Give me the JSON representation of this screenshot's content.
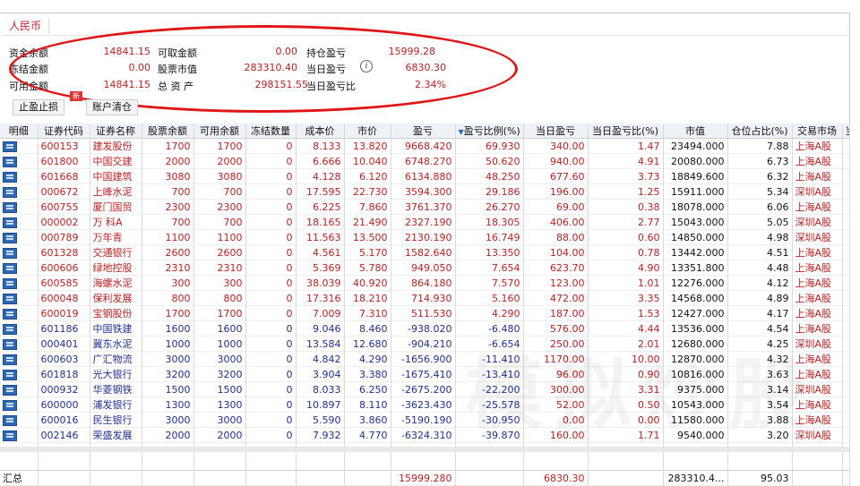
{
  "tab_currency": "人民币",
  "summary": {
    "fund_balance_label": "资金余额",
    "fund_balance": "14841.15",
    "withdrawable_label": "可取金额",
    "withdrawable": "0.00",
    "position_pl_label": "持仓盈亏",
    "position_pl": "15999.28",
    "frozen_label": "冻结金额",
    "frozen": "0.00",
    "stock_value_label": "股票市值",
    "stock_value": "283310.40",
    "today_pl_label": "当日盈亏",
    "today_pl": "6830.30",
    "available_label": "可用金额",
    "available": "14841.15",
    "total_assets_label": "总 资 产",
    "total_assets": "298151.55",
    "today_pl_ratio_label": "当日盈亏比",
    "today_pl_ratio": "2.34%"
  },
  "buttons": {
    "stop_label": "止盈止损",
    "clear_label": "账户清仓",
    "new_badge": "新"
  },
  "columns": [
    "明细",
    "证券代码",
    "证券名称",
    "股票余额",
    "可用余额",
    "冻结数量",
    "成本价",
    "市价",
    "盈亏",
    "盈亏比例(%)",
    "当日盈亏",
    "当日盈亏比(%)",
    "市值",
    "仓位占比(%)",
    "交易市场",
    "当"
  ],
  "rows": [
    {
      "code": "600153",
      "name": "建发股份",
      "bal": "1700",
      "avail": "1700",
      "frozen": "0",
      "cost": "8.133",
      "price": "13.820",
      "pl": "9668.420",
      "plr": "69.930",
      "tpl": "340.00",
      "tplr": "1.47",
      "mv": "23494.000",
      "pos": "7.88",
      "mkt": "上海A股",
      "sign": "up"
    },
    {
      "code": "601800",
      "name": "中国交建",
      "bal": "2000",
      "avail": "2000",
      "frozen": "0",
      "cost": "6.666",
      "price": "10.040",
      "pl": "6748.270",
      "plr": "50.620",
      "tpl": "940.00",
      "tplr": "4.91",
      "mv": "20080.000",
      "pos": "6.73",
      "mkt": "上海A股",
      "sign": "up"
    },
    {
      "code": "601668",
      "name": "中国建筑",
      "bal": "3080",
      "avail": "3080",
      "frozen": "0",
      "cost": "4.128",
      "price": "6.120",
      "pl": "6134.880",
      "plr": "48.250",
      "tpl": "677.60",
      "tplr": "3.73",
      "mv": "18849.600",
      "pos": "6.32",
      "mkt": "上海A股",
      "sign": "up"
    },
    {
      "code": "000672",
      "name": "上峰水泥",
      "bal": "700",
      "avail": "700",
      "frozen": "0",
      "cost": "17.595",
      "price": "22.730",
      "pl": "3594.300",
      "plr": "29.186",
      "tpl": "196.00",
      "tplr": "1.25",
      "mv": "15911.000",
      "pos": "5.34",
      "mkt": "深圳A股",
      "sign": "up"
    },
    {
      "code": "600755",
      "name": "厦门国贸",
      "bal": "2300",
      "avail": "2300",
      "frozen": "0",
      "cost": "6.225",
      "price": "7.860",
      "pl": "3761.370",
      "plr": "26.270",
      "tpl": "69.00",
      "tplr": "0.38",
      "mv": "18078.000",
      "pos": "6.06",
      "mkt": "上海A股",
      "sign": "up"
    },
    {
      "code": "000002",
      "name": "万 科A",
      "bal": "700",
      "avail": "700",
      "frozen": "0",
      "cost": "18.165",
      "price": "21.490",
      "pl": "2327.190",
      "plr": "18.305",
      "tpl": "406.00",
      "tplr": "2.77",
      "mv": "15043.000",
      "pos": "5.05",
      "mkt": "深圳A股",
      "sign": "up"
    },
    {
      "code": "000789",
      "name": "万年青",
      "bal": "1100",
      "avail": "1100",
      "frozen": "0",
      "cost": "11.563",
      "price": "13.500",
      "pl": "2130.190",
      "plr": "16.749",
      "tpl": "88.00",
      "tplr": "0.60",
      "mv": "14850.000",
      "pos": "4.98",
      "mkt": "深圳A股",
      "sign": "up"
    },
    {
      "code": "601328",
      "name": "交通银行",
      "bal": "2600",
      "avail": "2600",
      "frozen": "0",
      "cost": "4.561",
      "price": "5.170",
      "pl": "1582.640",
      "plr": "13.350",
      "tpl": "104.00",
      "tplr": "0.78",
      "mv": "13442.000",
      "pos": "4.51",
      "mkt": "上海A股",
      "sign": "up"
    },
    {
      "code": "600606",
      "name": "绿地控股",
      "bal": "2310",
      "avail": "2310",
      "frozen": "0",
      "cost": "5.369",
      "price": "5.780",
      "pl": "949.050",
      "plr": "7.654",
      "tpl": "623.70",
      "tplr": "4.90",
      "mv": "13351.800",
      "pos": "4.48",
      "mkt": "上海A股",
      "sign": "up"
    },
    {
      "code": "600585",
      "name": "海螺水泥",
      "bal": "300",
      "avail": "300",
      "frozen": "0",
      "cost": "38.039",
      "price": "40.920",
      "pl": "864.180",
      "plr": "7.570",
      "tpl": "123.00",
      "tplr": "1.01",
      "mv": "12276.000",
      "pos": "4.12",
      "mkt": "上海A股",
      "sign": "up"
    },
    {
      "code": "600048",
      "name": "保利发展",
      "bal": "800",
      "avail": "800",
      "frozen": "0",
      "cost": "17.316",
      "price": "18.210",
      "pl": "714.930",
      "plr": "5.160",
      "tpl": "472.00",
      "tplr": "3.35",
      "mv": "14568.000",
      "pos": "4.89",
      "mkt": "上海A股",
      "sign": "up"
    },
    {
      "code": "600019",
      "name": "宝钢股份",
      "bal": "1700",
      "avail": "1700",
      "frozen": "0",
      "cost": "7.009",
      "price": "7.310",
      "pl": "511.530",
      "plr": "4.290",
      "tpl": "187.00",
      "tplr": "1.53",
      "mv": "12427.000",
      "pos": "4.17",
      "mkt": "上海A股",
      "sign": "up"
    },
    {
      "code": "601186",
      "name": "中国铁建",
      "bal": "1600",
      "avail": "1600",
      "frozen": "0",
      "cost": "9.046",
      "price": "8.460",
      "pl": "-938.020",
      "plr": "-6.480",
      "tpl": "576.00",
      "tplr": "4.44",
      "mv": "13536.000",
      "pos": "4.54",
      "mkt": "上海A股",
      "sign": "down"
    },
    {
      "code": "000401",
      "name": "冀东水泥",
      "bal": "1000",
      "avail": "1000",
      "frozen": "0",
      "cost": "13.584",
      "price": "12.680",
      "pl": "-904.210",
      "plr": "-6.654",
      "tpl": "250.00",
      "tplr": "2.01",
      "mv": "12680.000",
      "pos": "4.25",
      "mkt": "深圳A股",
      "sign": "down"
    },
    {
      "code": "600603",
      "name": "广汇物流",
      "bal": "3000",
      "avail": "3000",
      "frozen": "0",
      "cost": "4.842",
      "price": "4.290",
      "pl": "-1656.900",
      "plr": "-11.410",
      "tpl": "1170.00",
      "tplr": "10.00",
      "mv": "12870.000",
      "pos": "4.32",
      "mkt": "上海A股",
      "sign": "down"
    },
    {
      "code": "601818",
      "name": "光大银行",
      "bal": "3200",
      "avail": "3200",
      "frozen": "0",
      "cost": "3.904",
      "price": "3.380",
      "pl": "-1675.410",
      "plr": "-13.410",
      "tpl": "96.00",
      "tplr": "0.90",
      "mv": "10816.000",
      "pos": "3.63",
      "mkt": "上海A股",
      "sign": "down"
    },
    {
      "code": "000932",
      "name": "华菱钢铁",
      "bal": "1500",
      "avail": "1500",
      "frozen": "0",
      "cost": "8.033",
      "price": "6.250",
      "pl": "-2675.200",
      "plr": "-22.200",
      "tpl": "300.00",
      "tplr": "3.31",
      "mv": "9375.000",
      "pos": "3.14",
      "mkt": "深圳A股",
      "sign": "down"
    },
    {
      "code": "600000",
      "name": "浦发银行",
      "bal": "1300",
      "avail": "1300",
      "frozen": "0",
      "cost": "10.897",
      "price": "8.110",
      "pl": "-3623.430",
      "plr": "-25.578",
      "tpl": "52.00",
      "tplr": "0.50",
      "mv": "10543.000",
      "pos": "3.54",
      "mkt": "上海A股",
      "sign": "down"
    },
    {
      "code": "600016",
      "name": "民生银行",
      "bal": "3000",
      "avail": "3000",
      "frozen": "0",
      "cost": "5.590",
      "price": "3.860",
      "pl": "-5190.190",
      "plr": "-30.950",
      "tpl": "0.00",
      "tplr": "0.00",
      "mv": "11580.000",
      "pos": "3.88",
      "mkt": "上海A股",
      "sign": "down"
    },
    {
      "code": "002146",
      "name": "荣盛发展",
      "bal": "2000",
      "avail": "2000",
      "frozen": "0",
      "cost": "7.932",
      "price": "4.770",
      "pl": "-6324.310",
      "plr": "-39.870",
      "tpl": "160.00",
      "tplr": "1.71",
      "mv": "9540.000",
      "pos": "3.20",
      "mkt": "深圳A股",
      "sign": "down"
    }
  ],
  "totals": {
    "label": "汇总",
    "pl": "15999.280",
    "tpl": "6830.30",
    "mv": "283310.4...",
    "pos": "95.03"
  },
  "colors": {
    "up": "#c41e1e",
    "down": "#1f2f9a",
    "ellipse": "#e01515",
    "header_bg": "#eef2f7"
  },
  "icons": {
    "detail": "detail-list-icon",
    "info": "info-circle-icon",
    "sort": "sort-down-icon"
  }
}
